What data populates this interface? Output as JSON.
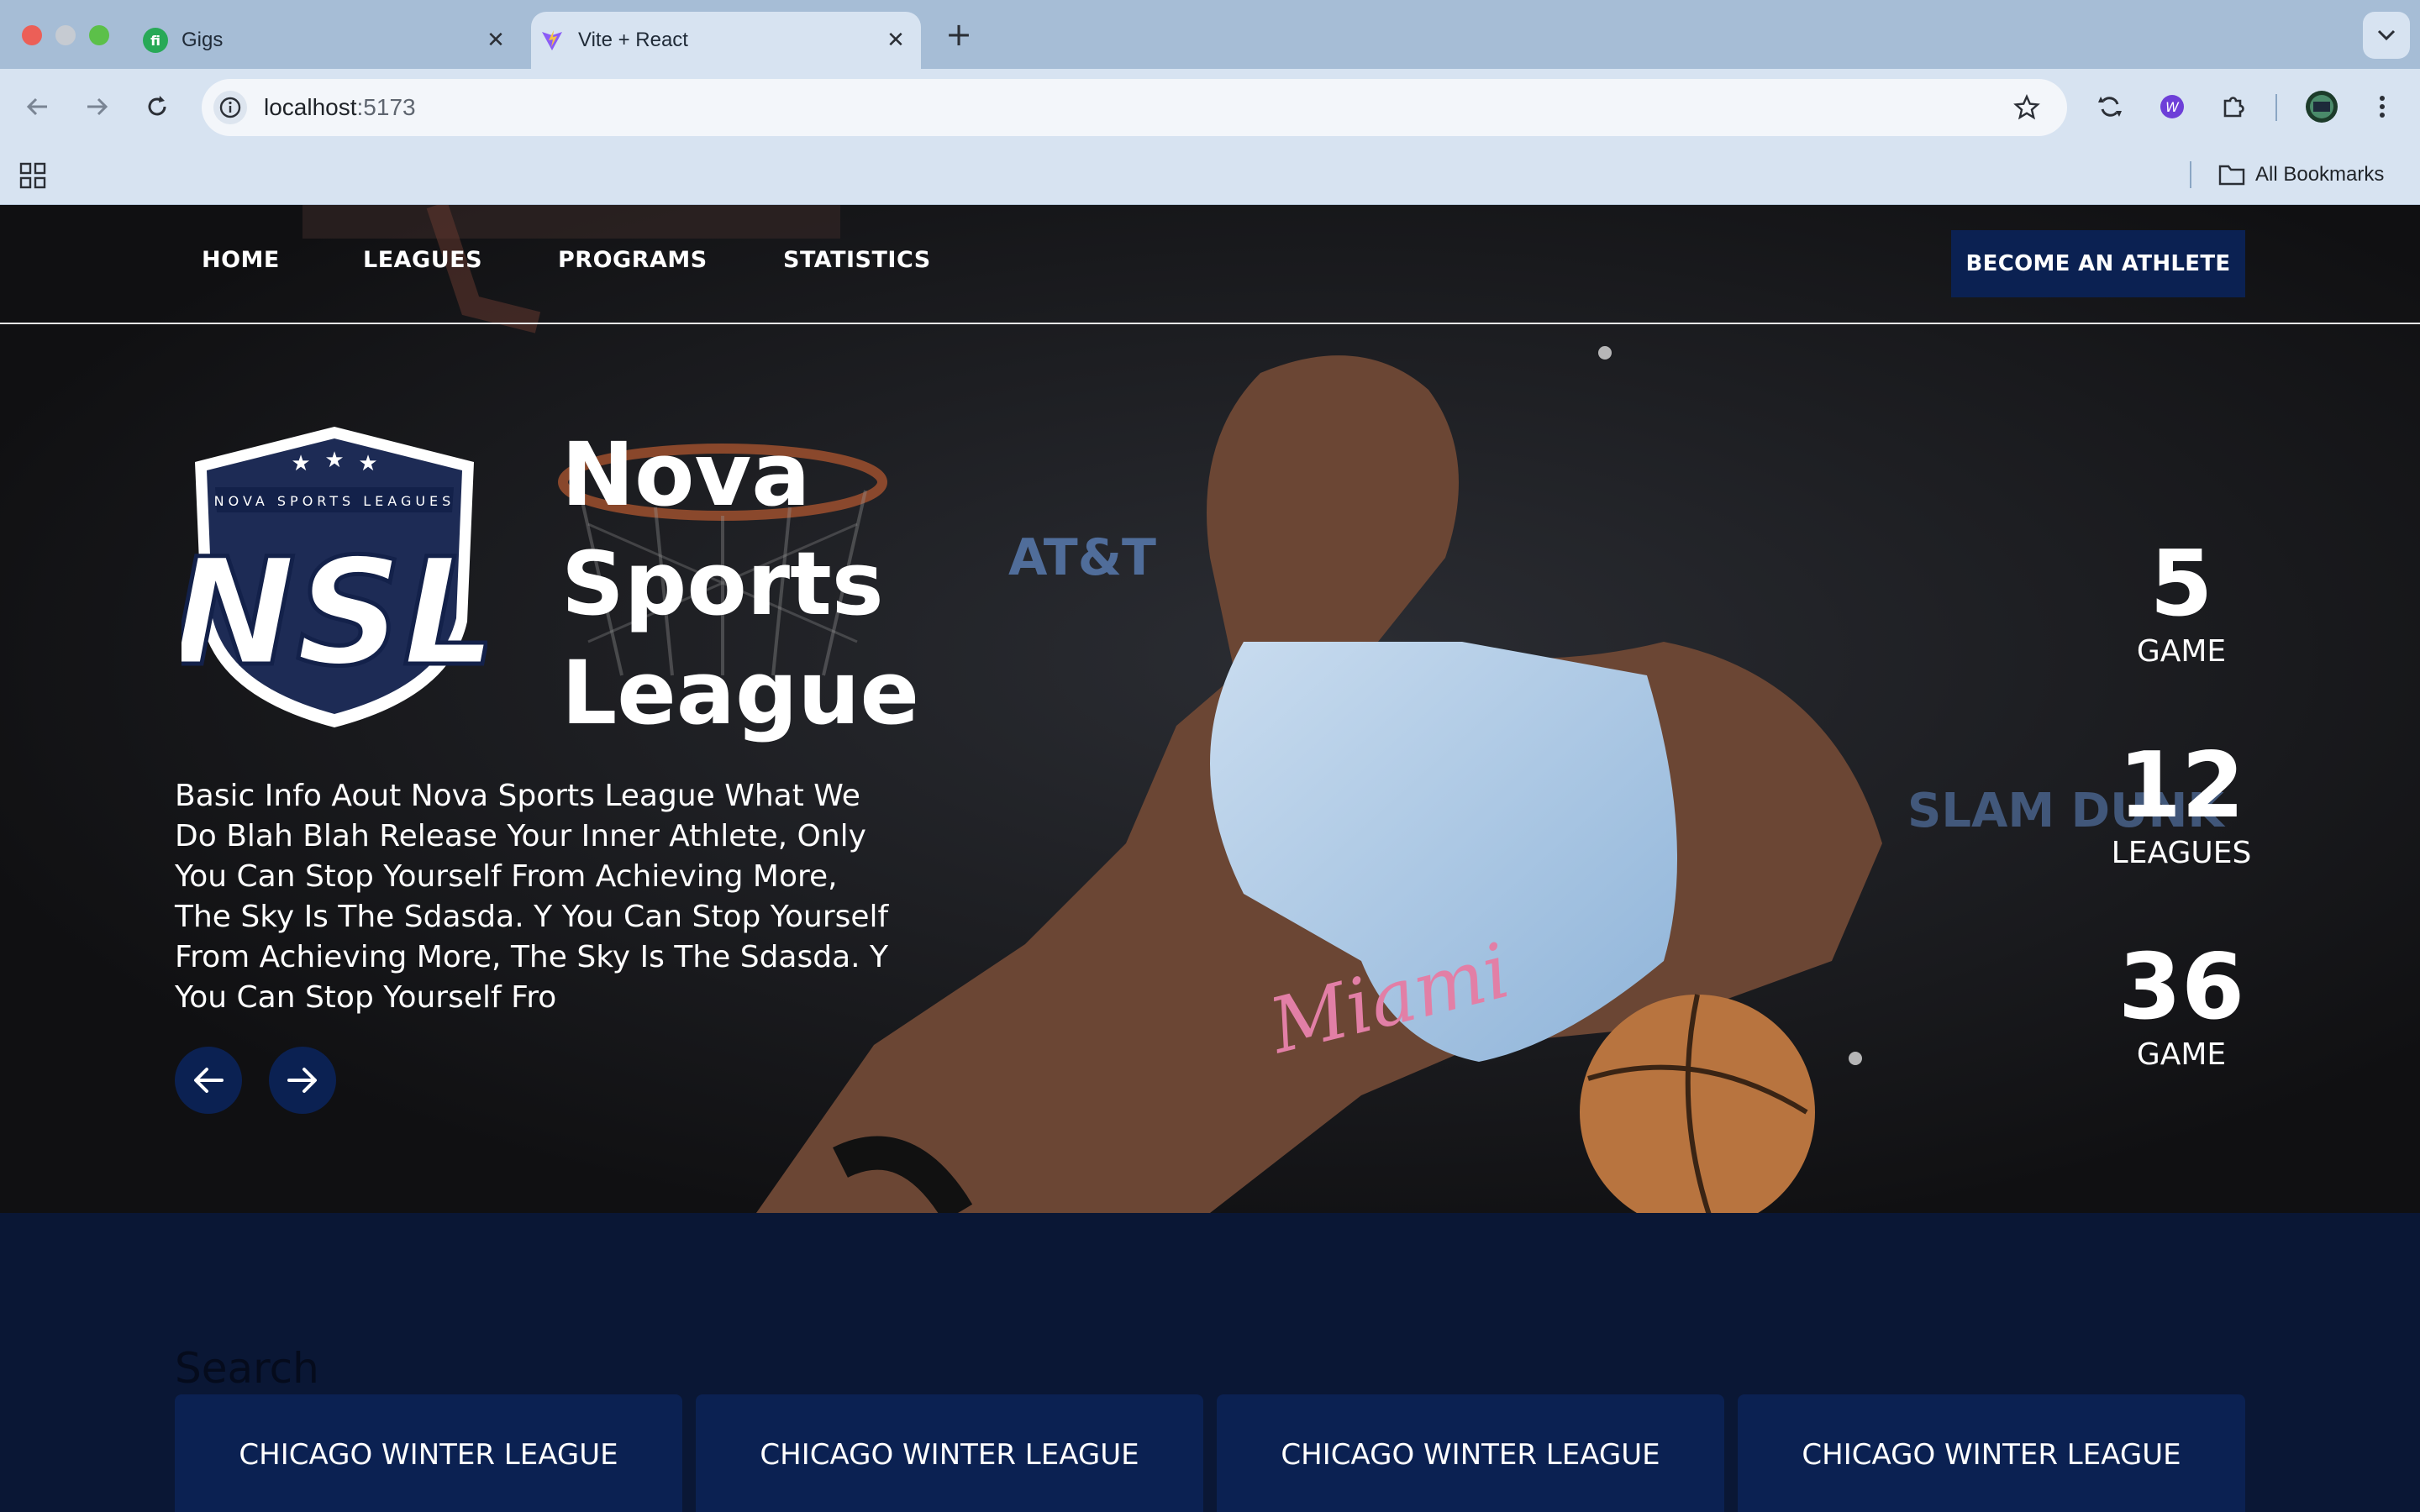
{
  "browser": {
    "tabs": [
      {
        "title": "Gigs",
        "active": false
      },
      {
        "title": "Vite + React",
        "active": true
      }
    ],
    "url_host": "localhost",
    "url_port": ":5173",
    "bookmarks_label": "All Bookmarks"
  },
  "site": {
    "nav": {
      "home": "HOME",
      "leagues": "LEAGUES",
      "programs": "PROGRAMS",
      "statistics": "STATISTICS",
      "cta": "BECOME AN ATHLETE"
    },
    "logo": {
      "top_text": "NOVA SPORTS LEAGUES",
      "mark": "NSL",
      "color_navy": "#0b2152"
    },
    "hero": {
      "title_line1": "Nova",
      "title_line2": "Sports",
      "title_line3": "League",
      "description": "Basic Info Aout Nova Sports League What We Do Blah Blah Release Your Inner Athlete, Only You Can Stop Yourself From Achieving More, The Sky Is The Sdasda. Y You Can Stop Yourself From Achieving More, The Sky Is The Sdasda. Y You Can Stop Yourself Fro",
      "prev_icon": "arrow-left-icon",
      "next_icon": "arrow-right-icon"
    },
    "stats": [
      {
        "value": "5",
        "label": "GAME"
      },
      {
        "value": "12",
        "label": "LEAGUES"
      },
      {
        "value": "36",
        "label": "GAME"
      }
    ],
    "search_label": "Search",
    "leagues": [
      {
        "name": "CHICAGO WINTER LEAGUE"
      },
      {
        "name": "CHICAGO WINTER LEAGUE"
      },
      {
        "name": "CHICAGO WINTER LEAGUE"
      },
      {
        "name": "CHICAGO WINTER LEAGUE"
      }
    ],
    "colors": {
      "brand_navy": "#0b2152",
      "page_bg": "#0a1735",
      "hero_bg": "#141414"
    }
  }
}
